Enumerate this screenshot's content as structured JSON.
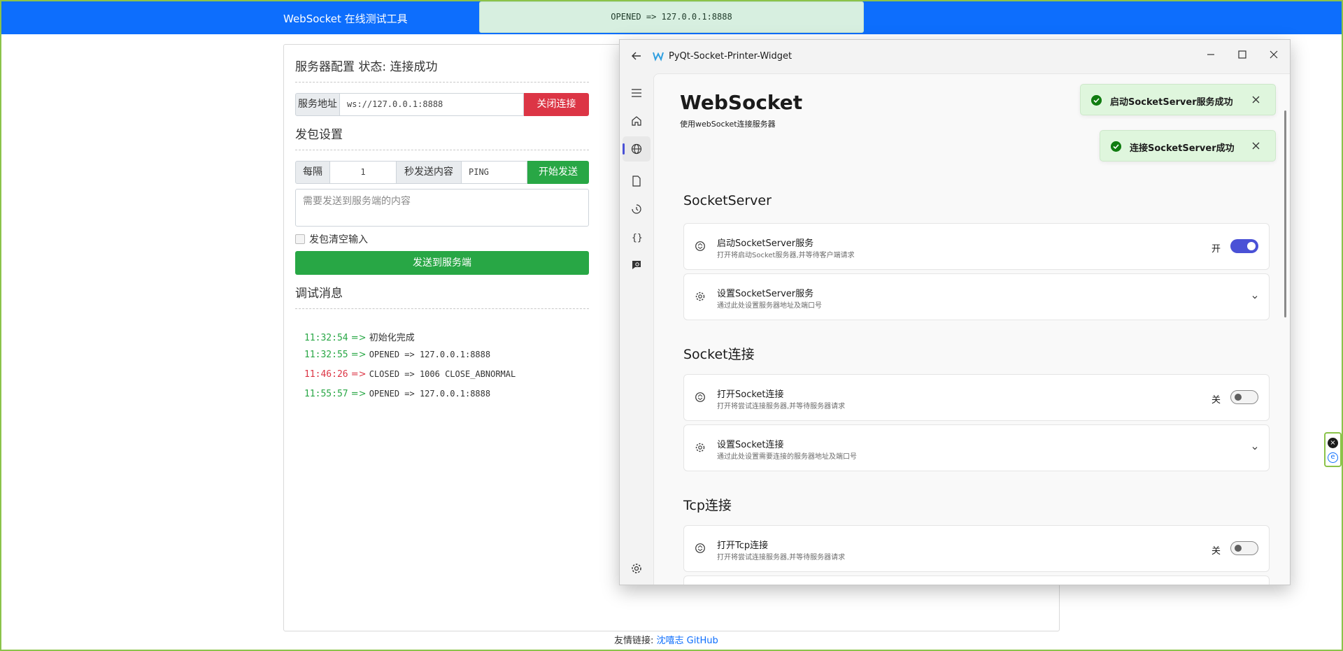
{
  "browser": {
    "brand": "WebSocket 在线测试工具",
    "banner": "OPENED => 127.0.0.1:8888"
  },
  "web": {
    "server_title": "服务器配置 状态: 连接成功",
    "address_label": "服务地址",
    "address_value": "ws://127.0.0.1:8888",
    "close_button": "关闭连接",
    "packet_title": "发包设置",
    "every_label": "每隔",
    "interval_value": "1",
    "seconds_label": "秒发送内容",
    "content_value": "PING",
    "start_button": "开始发送",
    "textarea_placeholder": "需要发送到服务端的内容",
    "clear_checkbox_label": "发包清空输入",
    "send_button": "发送到服务端",
    "debug_title": "调试消息",
    "log": [
      {
        "time": "11:32:54",
        "arrow": "=>",
        "msg": "初始化完成",
        "color": "#28a745"
      },
      {
        "time": "11:32:55",
        "arrow": "=>",
        "msg": "OPENED => 127.0.0.1:8888",
        "color": "#28a745"
      },
      {
        "time": "11:46:26",
        "arrow": "=>",
        "msg": "CLOSED => 1006 CLOSE_ABNORMAL",
        "color": "#dc3545"
      },
      {
        "time": "11:55:57",
        "arrow": "=>",
        "msg": "OPENED => 127.0.0.1:8888",
        "color": "#28a745"
      }
    ],
    "footer_label": "友情链接:",
    "footer_link": "沈嘻志 GitHub"
  },
  "app": {
    "window_title": "PyQt-Socket-Printer-Widget",
    "title": "WebSocket",
    "subtitle": "使用webSocket连接服务器",
    "accent": "#4a51d6",
    "toasts": [
      "启动SocketServer服务成功",
      "连接SocketServer成功"
    ],
    "groups": [
      {
        "title": "SocketServer",
        "cards": [
          {
            "icon": "sync-icon",
            "title": "启动SocketServer服务",
            "subtitle": "打开将启动Socket服务器,并等待客户端请求",
            "state": "开",
            "toggle": true
          },
          {
            "icon": "gear-icon",
            "title": "设置SocketServer服务",
            "subtitle": "通过此处设置服务器地址及端口号"
          }
        ]
      },
      {
        "title": "Socket连接",
        "cards": [
          {
            "icon": "sync-icon",
            "title": "打开Socket连接",
            "subtitle": "打开将尝试连接服务器,并等待服务器请求",
            "state": "关",
            "toggle": false
          },
          {
            "icon": "gear-icon",
            "title": "设置Socket连接",
            "subtitle": "通过此处设置需要连接的服务器地址及端口号"
          }
        ]
      },
      {
        "title": "Tcp连接",
        "cards": [
          {
            "icon": "sync-icon",
            "title": "打开Tcp连接",
            "subtitle": "打开将尝试连接服务器,并等待服务器请求",
            "state": "关",
            "toggle": false
          }
        ]
      }
    ]
  }
}
